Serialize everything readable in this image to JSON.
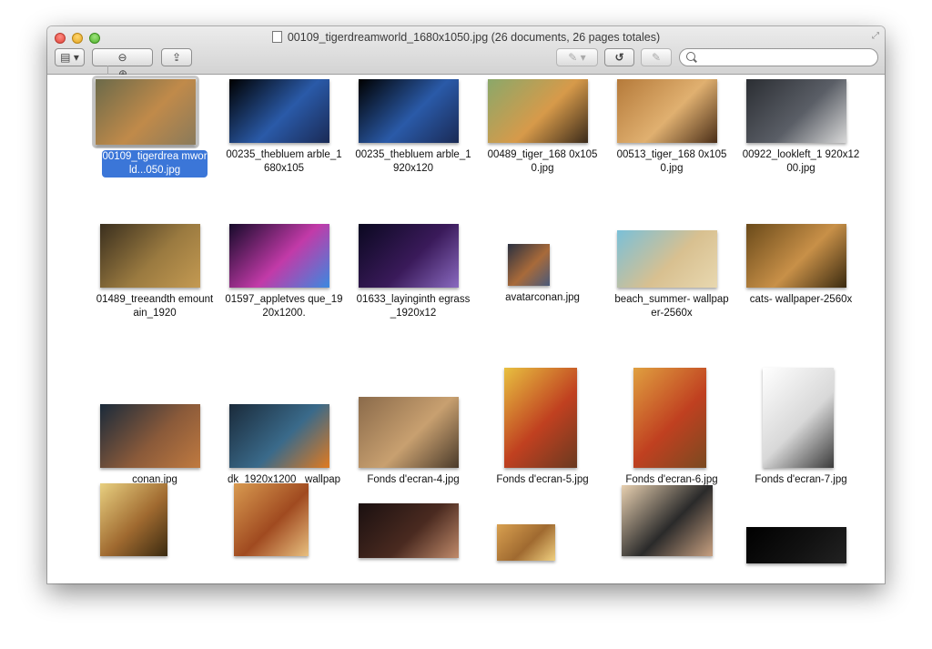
{
  "window": {
    "title": "00109_tigerdreamworld_1680x1050.jpg (26 documents, 26 pages totales)"
  },
  "toolbar": {
    "sidebar_button": "▤ ▾",
    "zoom_out": "⊖",
    "zoom_in": "⊕",
    "share": "⇪",
    "annotate_icon": "pencil-icon",
    "rotate_icon": "rotate-icon",
    "edit_icon": "edit-icon",
    "search_placeholder": ""
  },
  "items": [
    {
      "label": "00109_tigerdrea mworld...050.jpg",
      "selected": true,
      "colors": [
        "#6b6a4a",
        "#c08a4a",
        "#8a7a5a"
      ]
    },
    {
      "label": "00235_thebluem arble_1680x105",
      "colors": [
        "#000000",
        "#2a5aa8",
        "#1a2a55"
      ]
    },
    {
      "label": "00235_thebluem arble_1920x120",
      "colors": [
        "#000000",
        "#2a5aa8",
        "#1a2a55"
      ]
    },
    {
      "label": "00489_tiger_168 0x1050.jpg",
      "colors": [
        "#8aa86a",
        "#d79a4a",
        "#3a2a1a"
      ]
    },
    {
      "label": "00513_tiger_168 0x1050.jpg",
      "colors": [
        "#b57a3a",
        "#e0b070",
        "#4a2e18"
      ]
    },
    {
      "label": "00922_lookleft_1 920x1200.jpg",
      "colors": [
        "#2b2e33",
        "#5a5e66",
        "#d8d8d8"
      ]
    },
    {
      "label": "01489_treeandth emountain_1920",
      "colors": [
        "#3a2f1e",
        "#9a7a40",
        "#c49a52"
      ]
    },
    {
      "label": "01597_appletves que_1920x1200.",
      "colors": [
        "#160a2a",
        "#c23aa8",
        "#3a8ae0"
      ]
    },
    {
      "label": "01633_layinginth egrass_1920x12",
      "colors": [
        "#0a0820",
        "#3a1a5a",
        "#8a6ac0"
      ]
    },
    {
      "label": "avatarconan.jpg",
      "colors": [
        "#2a3040",
        "#a86a3a",
        "#4a5a7a"
      ]
    },
    {
      "label": "beach_summer- wallpaper-2560x",
      "colors": [
        "#7ac0d8",
        "#d8c090",
        "#e8d8b0"
      ]
    },
    {
      "label": "cats- wallpaper-2560x",
      "colors": [
        "#6a4a1a",
        "#c89048",
        "#3a2a10"
      ]
    },
    {
      "label": "conan.jpg",
      "colors": [
        "#1a2a3a",
        "#8a5a3a",
        "#c07a40"
      ]
    },
    {
      "label": "dk_1920x1200_ wallpaper.jpg",
      "colors": [
        "#1a2a3a",
        "#3a6a8a",
        "#e07a20"
      ]
    },
    {
      "label": "Fonds d'ecran-4.jpg",
      "colors": [
        "#8a6a4a",
        "#c8a070",
        "#4a3a2a"
      ]
    },
    {
      "label": "Fonds d'ecran-5.jpg",
      "colors": [
        "#e8c040",
        "#c04020",
        "#6a3a20"
      ]
    },
    {
      "label": "Fonds d'ecran-6.jpg",
      "colors": [
        "#e0a040",
        "#c04020",
        "#7a4a20"
      ]
    },
    {
      "label": "Fonds d'ecran-7.jpg",
      "colors": [
        "#ffffff",
        "#d8d8d8",
        "#3a3a3a"
      ]
    },
    {
      "label": "",
      "colors": [
        "#e8d080",
        "#a06a30",
        "#3a2a10"
      ]
    },
    {
      "label": "",
      "colors": [
        "#d89a50",
        "#a04a20",
        "#e8c080"
      ]
    },
    {
      "label": "",
      "colors": [
        "#1a1010",
        "#4a2a20",
        "#c08a6a"
      ]
    },
    {
      "label": "",
      "colors": [
        "#d8a050",
        "#a06a30",
        "#f0d080"
      ]
    },
    {
      "label": "",
      "colors": [
        "#e8d0b0",
        "#2a2a2a",
        "#c8a080"
      ]
    },
    {
      "label": "",
      "colors": [
        "#000000",
        "#111111",
        "#222222"
      ]
    }
  ]
}
